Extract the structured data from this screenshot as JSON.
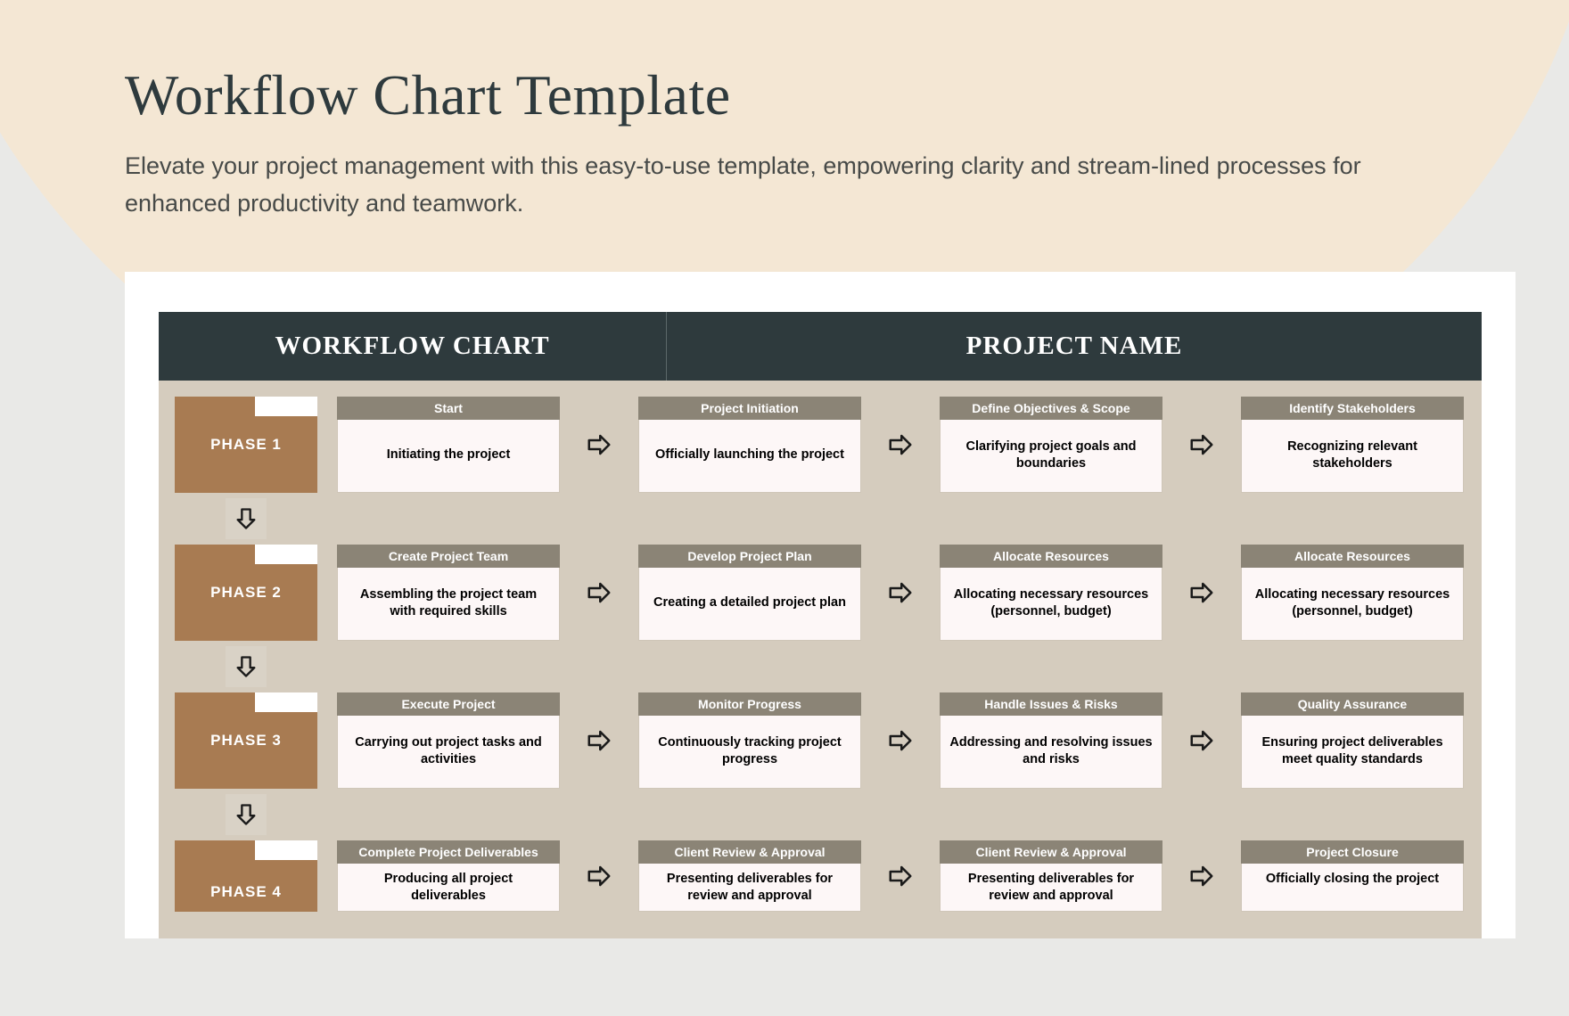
{
  "hero": {
    "title": "Workflow Chart Template",
    "subtitle": "Elevate your project management with this easy-to-use template, empowering clarity and stream-lined processes for enhanced productivity and teamwork."
  },
  "bar": {
    "left": "WORKFLOW CHART",
    "right": "PROJECT NAME"
  },
  "phases": [
    {
      "label": "PHASE 1",
      "steps": [
        {
          "head": "Start",
          "body": "Initiating the project"
        },
        {
          "head": "Project Initiation",
          "body": "Officially launching the project"
        },
        {
          "head": "Define Objectives & Scope",
          "body": "Clarifying project goals and boundaries"
        },
        {
          "head": "Identify Stakeholders",
          "body": "Recognizing relevant stakeholders"
        }
      ]
    },
    {
      "label": "PHASE 2",
      "steps": [
        {
          "head": "Create Project Team",
          "body": "Assembling the project team with required skills"
        },
        {
          "head": "Develop Project Plan",
          "body": "Creating a detailed project plan"
        },
        {
          "head": "Allocate Resources",
          "body": "Allocating necessary resources (personnel, budget)"
        },
        {
          "head": "Allocate Resources",
          "body": "Allocating necessary resources (personnel, budget)"
        }
      ]
    },
    {
      "label": "PHASE 3",
      "steps": [
        {
          "head": "Execute Project",
          "body": "Carrying out project tasks and activities"
        },
        {
          "head": "Monitor Progress",
          "body": "Continuously tracking project progress"
        },
        {
          "head": "Handle Issues & Risks",
          "body": "Addressing and resolving issues and risks"
        },
        {
          "head": "Quality Assurance",
          "body": "Ensuring project deliverables meet quality standards"
        }
      ]
    },
    {
      "label": "PHASE 4",
      "steps": [
        {
          "head": "Complete Project Deliverables",
          "body": "Producing all project deliverables"
        },
        {
          "head": "Client Review & Approval",
          "body": "Presenting deliverables for review and approval"
        },
        {
          "head": "Client Review & Approval",
          "body": "Presenting deliverables for review and approval"
        },
        {
          "head": "Project Closure",
          "body": "Officially closing the project"
        }
      ]
    }
  ]
}
